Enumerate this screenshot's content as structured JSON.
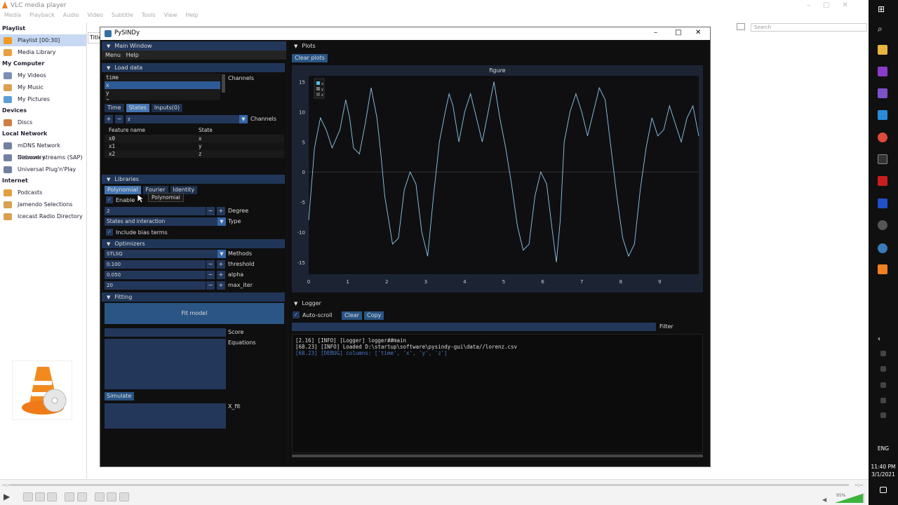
{
  "vlc": {
    "title": "VLC media player",
    "menu": [
      "Media",
      "Playback",
      "Audio",
      "Video",
      "Subtitle",
      "Tools",
      "View",
      "Help"
    ],
    "sidebar": [
      {
        "h": "Playlist"
      },
      {
        "i": "Playlist [00:30]",
        "sel": true,
        "c": "#f39a1f"
      },
      {
        "i": "Media Library",
        "c": "#e8a040"
      },
      {
        "h": "My Computer"
      },
      {
        "i": "My Videos",
        "c": "#7b8fb5"
      },
      {
        "i": "My Music",
        "c": "#d9a050"
      },
      {
        "i": "My Pictures",
        "c": "#5b9ed8"
      },
      {
        "h": "Devices"
      },
      {
        "i": "Discs",
        "c": "#cc8040"
      },
      {
        "h": "Local Network"
      },
      {
        "i": "mDNS Network Discovery",
        "c": "#7080a0"
      },
      {
        "i": "Network streams (SAP)",
        "c": "#7080a0"
      },
      {
        "i": "Universal Plug'n'Play",
        "c": "#7080a0"
      },
      {
        "h": "Internet"
      },
      {
        "i": "Podcasts",
        "c": "#e0a040"
      },
      {
        "i": "Jamendo Selections",
        "c": "#d9a050"
      },
      {
        "i": "Icecast Radio Directory",
        "c": "#d9a050"
      }
    ],
    "tab_title": "Title",
    "search_placeholder": "Search",
    "time_left": "--:--",
    "time_right": "--:--",
    "volume": "95%"
  },
  "win": {
    "title": "PySINDy",
    "main_window": "Main Window",
    "menu": "Menu",
    "help": "Help",
    "load_data": "Load data",
    "channels_list": [
      "time",
      "x",
      "y",
      "z"
    ],
    "channels_label": "Channels",
    "tabs": [
      "Time",
      "States",
      "Inputs(0)"
    ],
    "channel_sel": "z",
    "channels2": "Channels",
    "feat_head": [
      "Feature name",
      "State"
    ],
    "feat_rows": [
      [
        "x0",
        "x"
      ],
      [
        "x1",
        "y"
      ],
      [
        "x2",
        "z"
      ]
    ],
    "libraries": "Libraries",
    "lib_tabs": [
      "Polynomial",
      "Fourier",
      "Identity"
    ],
    "tooltip": "Polynomial",
    "enable": "Enable",
    "degree_val": "2",
    "degree": "Degree",
    "type_val": "States and interaction",
    "type": "Type",
    "bias": "Include bias terms",
    "optimizers": "Optimizers",
    "method_val": "STLSQ",
    "methods": "Methods",
    "opt_rows": [
      [
        "0.100",
        "threshold"
      ],
      [
        "0.050",
        "alpha"
      ],
      [
        "20",
        "max_iter"
      ]
    ],
    "fitting": "Fitting",
    "fit": "Fit model",
    "score": "Score",
    "equations": "Equations",
    "simulate": "Simulate",
    "x_fit": "X_fit",
    "plots": "Plots",
    "clear_plots": "Clear plots",
    "logger": "Logger",
    "autoscroll": "Auto-scroll",
    "clear": "Clear",
    "copy": "Copy",
    "filter": "Filter",
    "log": [
      {
        "t": "[2.16] [INFO]  [Logger] logger##main",
        "c": "#ddd"
      },
      {
        "t": "[68.23] [INFO]  Loaded D:\\startup\\software\\pysindy-gui\\data//lorenz.csv",
        "c": "#ddd"
      },
      {
        "t": "[68.23] [DEBUG]  columns: ['time', 'x', 'y', 'z']",
        "c": "#4a78c8"
      }
    ]
  },
  "clock": {
    "time": "11:40 PM",
    "date": "3/1/2021",
    "lang": "ENG"
  },
  "chart_data": {
    "type": "line",
    "title": "figure",
    "xlim": [
      0,
      10
    ],
    "ylim": [
      -17,
      16
    ],
    "xticks": [
      0,
      1,
      2,
      3,
      4,
      5,
      6,
      7,
      8,
      9
    ],
    "yticks": [
      15,
      10,
      5,
      0,
      -5,
      -10,
      -15
    ],
    "legend": [
      "x",
      "y",
      "z"
    ],
    "legend_colors": [
      "#4fc3e8",
      "#777",
      "#555"
    ],
    "series": [
      {
        "name": "x",
        "color": "#8ec8e8",
        "x": [
          0,
          0.05,
          0.15,
          0.3,
          0.45,
          0.6,
          0.8,
          0.95,
          1.05,
          1.15,
          1.3,
          1.45,
          1.6,
          1.75,
          1.85,
          1.95,
          2.05,
          2.15,
          2.3,
          2.45,
          2.6,
          2.75,
          2.9,
          3.05,
          3.2,
          3.35,
          3.5,
          3.6,
          3.7,
          3.85,
          4.0,
          4.15,
          4.3,
          4.45,
          4.6,
          4.75,
          4.9,
          5.05,
          5.2,
          5.35,
          5.5,
          5.65,
          5.8,
          5.95,
          6.1,
          6.25,
          6.35,
          6.45,
          6.55,
          6.7,
          6.85,
          7.0,
          7.15,
          7.3,
          7.45,
          7.6,
          7.75,
          7.9,
          8.05,
          8.2,
          8.35,
          8.5,
          8.65,
          8.8,
          8.95,
          9.1,
          9.25,
          9.4,
          9.55,
          9.7,
          9.85,
          10.0
        ],
        "y": [
          -8,
          -4,
          4,
          9,
          7,
          4,
          7,
          12,
          9,
          4,
          3,
          8,
          14,
          9,
          3,
          -4,
          -8,
          -12,
          -11,
          -3,
          0,
          -2,
          -10,
          -14,
          -4,
          5,
          10,
          13,
          11,
          5,
          10,
          13,
          9,
          5,
          10,
          15,
          9,
          4,
          -2,
          -9,
          -13,
          -12,
          -4,
          0,
          -2,
          -10,
          -15,
          -8,
          5,
          10,
          13,
          10,
          6,
          10,
          14,
          12,
          4,
          -4,
          -11,
          -14,
          -12,
          -3,
          4,
          9,
          6,
          7,
          11,
          8,
          5,
          9,
          11,
          6
        ]
      }
    ]
  }
}
